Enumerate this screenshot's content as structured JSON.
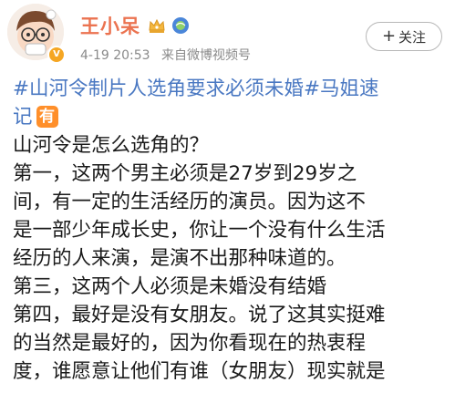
{
  "post": {
    "username": "王小呆",
    "date": "4-19 20:53",
    "source": "来自微博视频号",
    "follow_label": "关注",
    "follow_icon": "plus-icon",
    "topic_line_1": "#山河令制片人选角要求必须未婚#马姐速",
    "topic_line_2": "记",
    "topic_badge": "有",
    "body_lines": [
      "山河令是怎么选角的？",
      "第一，这两个男主必须是27岁到29岁之",
      "间，有一定的生活经历的演员。因为这不",
      "是一部少年成长史，你让一个没有什么生活",
      "经历的人来演，是演不出那种味道的。",
      "第三，这两个人必须是未婚没有结婚",
      "第四，最好是没有女朋友。说了这其实挺难",
      "的当然是最好的，因为你看现在的热衷程",
      "度，谁愿意让他们有谁（女朋友）现实就是"
    ]
  },
  "colors": {
    "username": "#eb7350",
    "topic": "#4a78c2",
    "badge": "#ff8f2a",
    "meta": "#8a8a8a"
  }
}
